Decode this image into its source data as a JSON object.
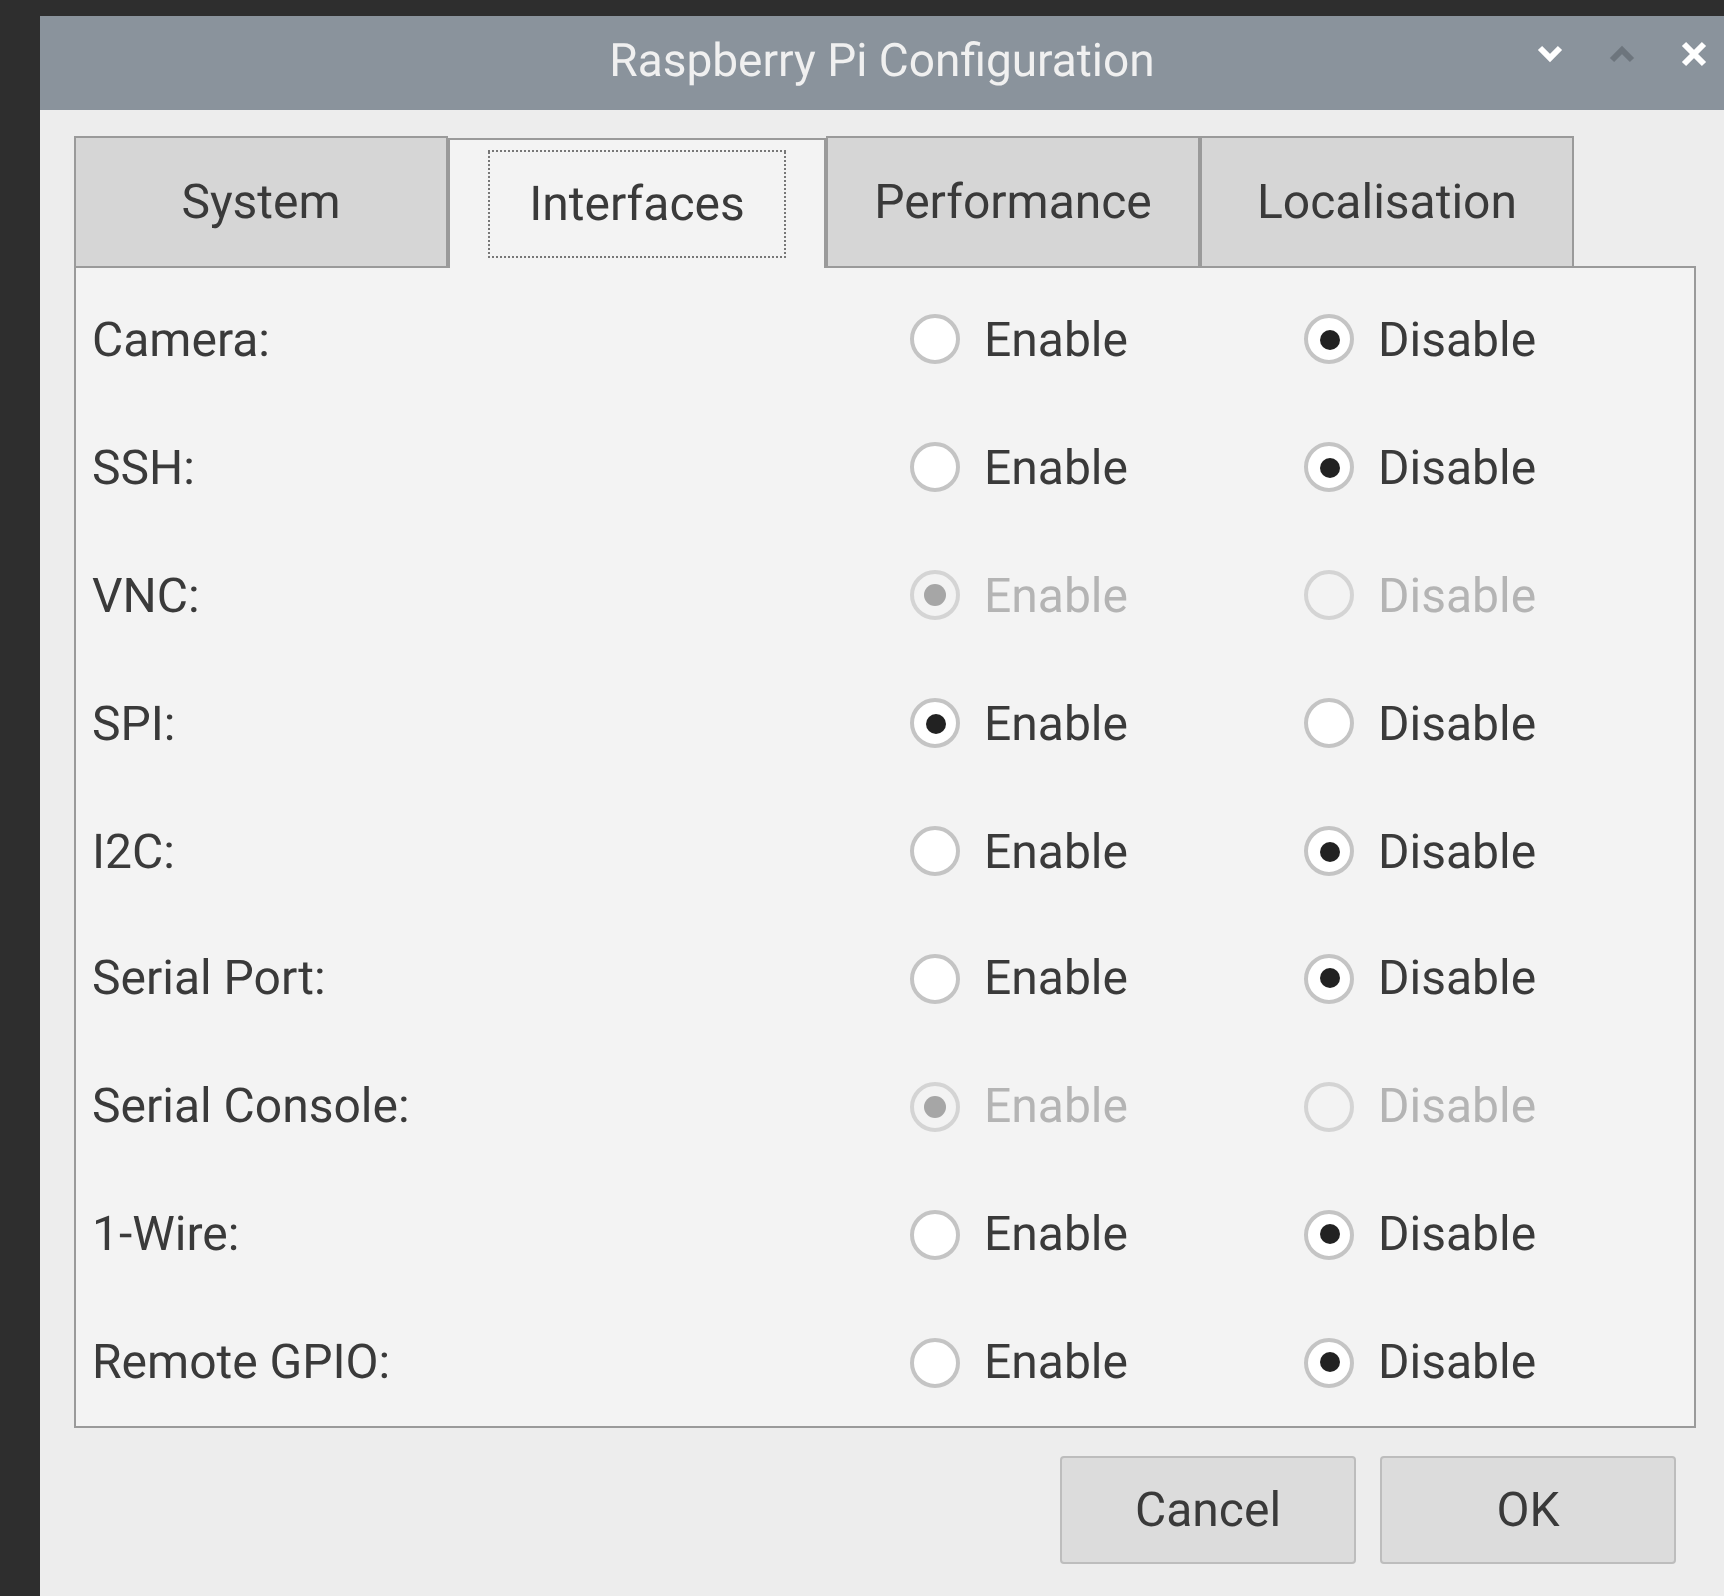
{
  "window": {
    "title": "Raspberry Pi Configuration"
  },
  "tabs": [
    {
      "label": "System",
      "selected": false
    },
    {
      "label": "Interfaces",
      "selected": true
    },
    {
      "label": "Performance",
      "selected": false
    },
    {
      "label": "Localisation",
      "selected": false
    }
  ],
  "rows": [
    {
      "label": "Camera:",
      "disabled": false,
      "options": [
        {
          "label": "Enable",
          "selected": false
        },
        {
          "label": "Disable",
          "selected": true
        }
      ]
    },
    {
      "label": "SSH:",
      "disabled": false,
      "options": [
        {
          "label": "Enable",
          "selected": false
        },
        {
          "label": "Disable",
          "selected": true
        }
      ]
    },
    {
      "label": "VNC:",
      "disabled": true,
      "options": [
        {
          "label": "Enable",
          "selected": true
        },
        {
          "label": "Disable",
          "selected": false
        }
      ]
    },
    {
      "label": "SPI:",
      "disabled": false,
      "options": [
        {
          "label": "Enable",
          "selected": true
        },
        {
          "label": "Disable",
          "selected": false
        }
      ]
    },
    {
      "label": "I2C:",
      "disabled": false,
      "options": [
        {
          "label": "Enable",
          "selected": false
        },
        {
          "label": "Disable",
          "selected": true
        }
      ]
    },
    {
      "label": "Serial Port:",
      "disabled": false,
      "options": [
        {
          "label": "Enable",
          "selected": false
        },
        {
          "label": "Disable",
          "selected": true
        }
      ]
    },
    {
      "label": "Serial Console:",
      "disabled": true,
      "options": [
        {
          "label": "Enable",
          "selected": true
        },
        {
          "label": "Disable",
          "selected": false
        }
      ]
    },
    {
      "label": "1-Wire:",
      "disabled": false,
      "options": [
        {
          "label": "Enable",
          "selected": false
        },
        {
          "label": "Disable",
          "selected": true
        }
      ]
    },
    {
      "label": "Remote GPIO:",
      "disabled": false,
      "options": [
        {
          "label": "Enable",
          "selected": false
        },
        {
          "label": "Disable",
          "selected": true
        }
      ]
    }
  ],
  "buttons": [
    "Cancel",
    "OK"
  ]
}
